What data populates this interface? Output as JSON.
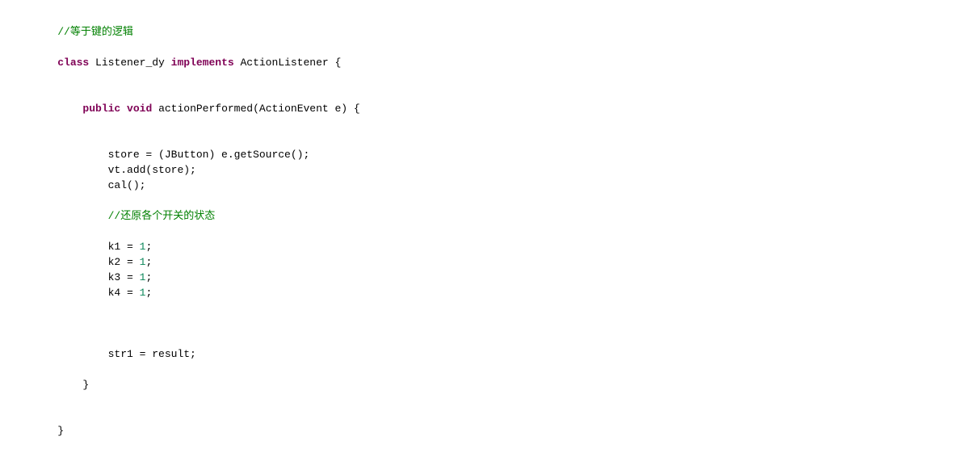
{
  "code": {
    "comment_top": "//等于键的逻辑",
    "kw_class": "class",
    "class_name": " Listener_dy ",
    "kw_implements": "implements",
    "impl_name": " ActionListener {",
    "kw_public": "public",
    "space1": " ",
    "kw_void": "void",
    "method_sig": " actionPerformed(ActionEvent e) {",
    "line_store": "store = (JButton) e.getSource();",
    "line_vt": "vt.add(store);",
    "line_cal": "cal();",
    "comment_reset": "//还原各个开关的状态",
    "k1_pre": "k1 = ",
    "k1_val": "1",
    "k1_post": ";",
    "k2_pre": "k2 = ",
    "k2_val": "1",
    "k2_post": ";",
    "k3_pre": "k3 = ",
    "k3_val": "1",
    "k3_post": ";",
    "k4_pre": "k4 = ",
    "k4_val": "1",
    "k4_post": ";",
    "line_str1": "str1 = result;",
    "brace_close_method": "}",
    "brace_close_class": "}"
  }
}
